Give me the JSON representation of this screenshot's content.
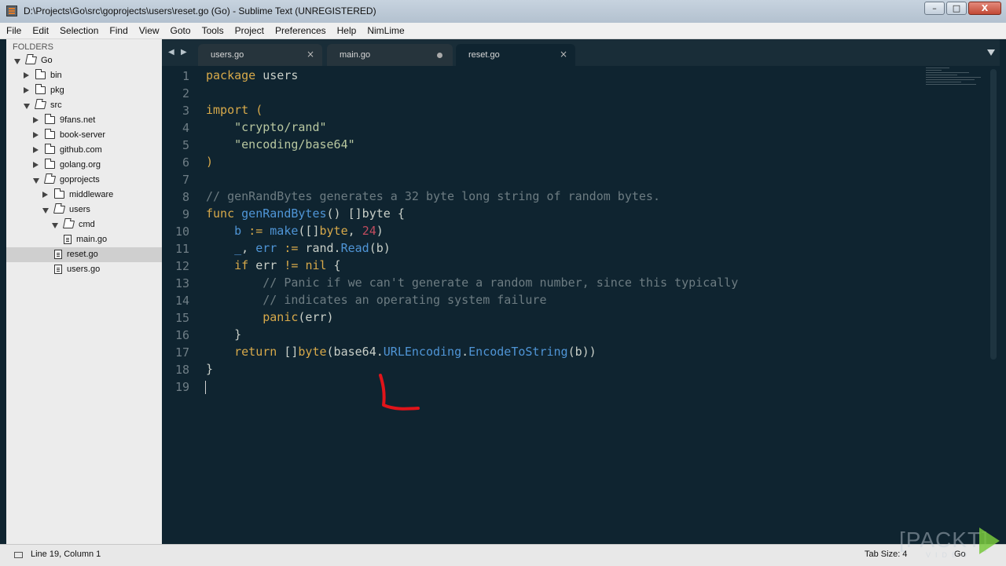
{
  "window": {
    "title": "D:\\Projects\\Go\\src\\goprojects\\users\\reset.go (Go) - Sublime Text (UNREGISTERED)",
    "buttons": [
      "–",
      "□",
      "X"
    ]
  },
  "menu": [
    "File",
    "Edit",
    "Selection",
    "Find",
    "View",
    "Goto",
    "Tools",
    "Project",
    "Preferences",
    "Help",
    "NimLime"
  ],
  "sidebar": {
    "heading": "FOLDERS",
    "tree": [
      {
        "label": "Go",
        "type": "folder",
        "state": "open",
        "depth": 0
      },
      {
        "label": "bin",
        "type": "folder",
        "state": "closed",
        "depth": 1
      },
      {
        "label": "pkg",
        "type": "folder",
        "state": "closed",
        "depth": 1
      },
      {
        "label": "src",
        "type": "folder",
        "state": "open",
        "depth": 1
      },
      {
        "label": "9fans.net",
        "type": "folder",
        "state": "closed",
        "depth": 2
      },
      {
        "label": "book-server",
        "type": "folder",
        "state": "closed",
        "depth": 2
      },
      {
        "label": "github.com",
        "type": "folder",
        "state": "closed",
        "depth": 2
      },
      {
        "label": "golang.org",
        "type": "folder",
        "state": "closed",
        "depth": 2
      },
      {
        "label": "goprojects",
        "type": "folder",
        "state": "open",
        "depth": 2
      },
      {
        "label": "middleware",
        "type": "folder",
        "state": "closed",
        "depth": 3
      },
      {
        "label": "users",
        "type": "folder",
        "state": "open",
        "depth": 3
      },
      {
        "label": "cmd",
        "type": "folder",
        "state": "open",
        "depth": 4
      },
      {
        "label": "main.go",
        "type": "file",
        "depth": 5
      },
      {
        "label": "reset.go",
        "type": "file",
        "depth": 4,
        "selected": true
      },
      {
        "label": "users.go",
        "type": "file",
        "depth": 4
      }
    ]
  },
  "tabs": [
    {
      "label": "users.go",
      "state": "close"
    },
    {
      "label": "main.go",
      "state": "dirty"
    },
    {
      "label": "reset.go",
      "state": "close",
      "active": true
    }
  ],
  "editor": {
    "lines": [
      [
        [
          "kw",
          "package"
        ],
        [
          "plain",
          " users"
        ]
      ],
      [],
      [
        [
          "kw",
          "import"
        ],
        [
          "plain",
          " "
        ],
        [
          "kw",
          "("
        ]
      ],
      [
        [
          "plain",
          "    "
        ],
        [
          "str",
          "\"crypto/rand\""
        ]
      ],
      [
        [
          "plain",
          "    "
        ],
        [
          "str",
          "\"encoding/base64\""
        ]
      ],
      [
        [
          "kw",
          ")"
        ]
      ],
      [],
      [
        [
          "com",
          "// genRandBytes generates a 32 byte long string of random bytes."
        ]
      ],
      [
        [
          "kw",
          "func"
        ],
        [
          "plain",
          " "
        ],
        [
          "fn",
          "genRandBytes"
        ],
        [
          "plain",
          "() []byte {"
        ]
      ],
      [
        [
          "plain",
          "    "
        ],
        [
          "var",
          "b"
        ],
        [
          "plain",
          " "
        ],
        [
          "kw",
          ":="
        ],
        [
          "plain",
          " "
        ],
        [
          "fn",
          "make"
        ],
        [
          "plain",
          "([]"
        ],
        [
          "kw",
          "byte"
        ],
        [
          "plain",
          ", "
        ],
        [
          "num",
          "24"
        ],
        [
          "plain",
          ")"
        ]
      ],
      [
        [
          "plain",
          "    "
        ],
        [
          "var",
          "_"
        ],
        [
          "plain",
          ", "
        ],
        [
          "var",
          "err"
        ],
        [
          "plain",
          " "
        ],
        [
          "kw",
          ":="
        ],
        [
          "plain",
          " rand."
        ],
        [
          "fn",
          "Read"
        ],
        [
          "plain",
          "(b)"
        ]
      ],
      [
        [
          "plain",
          "    "
        ],
        [
          "kw",
          "if"
        ],
        [
          "plain",
          " err "
        ],
        [
          "kw",
          "!="
        ],
        [
          "plain",
          " "
        ],
        [
          "kw",
          "nil"
        ],
        [
          "plain",
          " {"
        ]
      ],
      [
        [
          "plain",
          "        "
        ],
        [
          "com",
          "// Panic if we can't generate a random number, since this typically"
        ]
      ],
      [
        [
          "plain",
          "        "
        ],
        [
          "com",
          "// indicates an operating system failure"
        ]
      ],
      [
        [
          "plain",
          "        "
        ],
        [
          "kw",
          "panic"
        ],
        [
          "plain",
          "(err)"
        ]
      ],
      [
        [
          "plain",
          "    }"
        ]
      ],
      [
        [
          "plain",
          "    "
        ],
        [
          "kw",
          "return"
        ],
        [
          "plain",
          " []"
        ],
        [
          "kw",
          "byte"
        ],
        [
          "plain",
          "(base64."
        ],
        [
          "fn",
          "URLEncoding"
        ],
        [
          "plain",
          "."
        ],
        [
          "fn",
          "EncodeToString"
        ],
        [
          "plain",
          "(b))"
        ]
      ],
      [
        [
          "plain",
          "}"
        ]
      ],
      []
    ],
    "cursor_line": 19
  },
  "status": {
    "position": "Line 19, Column 1",
    "tab_size": "Tab Size: 4",
    "syntax": "Go"
  },
  "watermark": {
    "brand": "[PACKT]",
    "sub": "VIDEO"
  }
}
